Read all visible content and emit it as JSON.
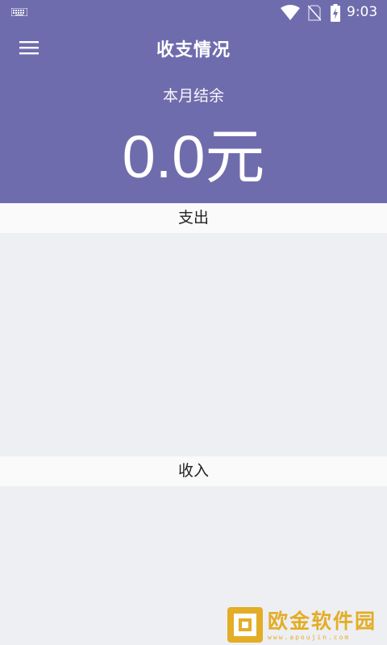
{
  "status_bar": {
    "time": "9:03",
    "icons": [
      "keyboard-icon",
      "wifi-icon",
      "no-sim-icon",
      "battery-charging-icon"
    ]
  },
  "header": {
    "title": "收支情况",
    "menu_icon": "hamburger-menu-icon",
    "balance_label": "本月结余",
    "balance_value": "0.0元",
    "background_color": "#6f6cad"
  },
  "sections": {
    "expense_label": "支出",
    "income_label": "收入"
  },
  "watermark": {
    "text": "欧金软件园",
    "url": "www.apoujin.com",
    "color": "#e3ad25"
  }
}
